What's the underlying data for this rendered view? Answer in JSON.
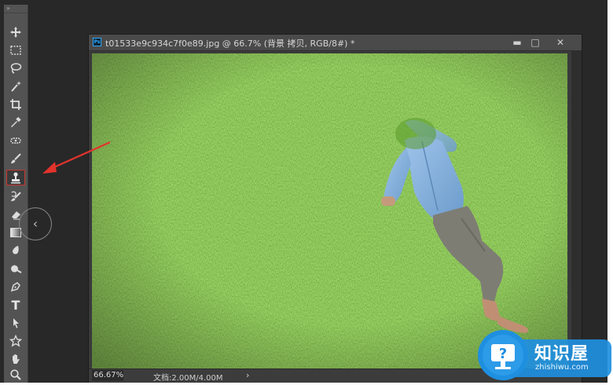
{
  "document": {
    "title": "t01533e9c934c7f0e89.jpg @ 66.7% (背景 拷贝, RGB/8#) *",
    "app_icon": "Ps",
    "minimize": "▬",
    "maximize": "□",
    "close": "✕"
  },
  "statusbar": {
    "zoom": "66.67%",
    "doc_size": "文档:2.00M/4.00M",
    "arrow": "›"
  },
  "tools_panel": {
    "grip": "»",
    "items": [
      {
        "name": "move-tool",
        "icon": "move-icon"
      },
      {
        "name": "rectangular-marquee-tool",
        "icon": "marquee-icon"
      },
      {
        "name": "lasso-tool",
        "icon": "lasso-icon"
      },
      {
        "name": "magic-wand-tool",
        "icon": "magic-wand-icon"
      },
      {
        "name": "crop-tool",
        "icon": "crop-icon"
      },
      {
        "name": "eyedropper-tool",
        "icon": "eyedropper-icon"
      },
      {
        "name": "spot-healing-tool",
        "icon": "healing-icon"
      },
      {
        "name": "brush-tool",
        "icon": "brush-icon"
      },
      {
        "name": "clone-stamp-tool",
        "icon": "clone-stamp-icon",
        "selected": true
      },
      {
        "name": "history-brush-tool",
        "icon": "history-brush-icon"
      },
      {
        "name": "eraser-tool",
        "icon": "eraser-icon"
      },
      {
        "name": "gradient-tool",
        "icon": "gradient-icon"
      },
      {
        "name": "blur-tool",
        "icon": "blur-icon"
      },
      {
        "name": "dodge-tool",
        "icon": "dodge-icon"
      },
      {
        "name": "pen-tool",
        "icon": "pen-icon"
      },
      {
        "name": "type-tool",
        "icon": "type-icon",
        "label": "T"
      },
      {
        "name": "path-selection-tool",
        "icon": "arrow-icon"
      },
      {
        "name": "custom-shape-tool",
        "icon": "shape-icon"
      },
      {
        "name": "hand-tool",
        "icon": "hand-icon"
      },
      {
        "name": "zoom-tool",
        "icon": "zoom-icon"
      }
    ]
  },
  "collapse_arrow": "‹",
  "watermark": {
    "cn": "知识屋",
    "en": "zhishiwu.com"
  },
  "colors": {
    "workspace": "#282828",
    "panel": "#535353",
    "grass": "#4e8a22",
    "annotation_red": "#e2332b",
    "watermark_blue": "#1f8fe0"
  }
}
